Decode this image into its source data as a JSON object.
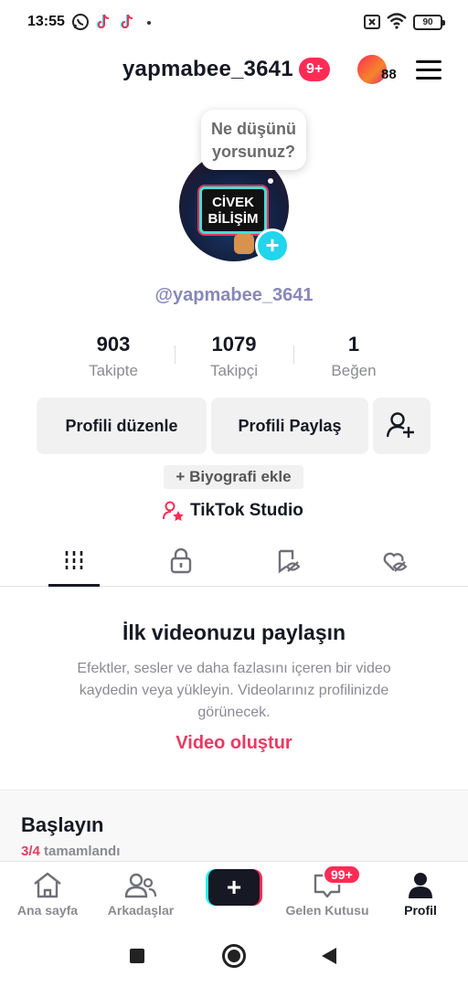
{
  "status_bar": {
    "time": "13:55",
    "battery": "90"
  },
  "header": {
    "username": "yapmabee_3641",
    "notification_badge": "9+",
    "stories_count": "88"
  },
  "profile": {
    "avatar_text_line1": "CİVEK",
    "avatar_text_line2": "BİLİŞİM",
    "thought_bubble_line1": "Ne düşünü",
    "thought_bubble_line2": "yorsunuz?",
    "handle": "@yapmabee_3641"
  },
  "stats": [
    {
      "value": "903",
      "label": "Takipte"
    },
    {
      "value": "1079",
      "label": "Takipçi"
    },
    {
      "value": "1",
      "label": "Beğen"
    }
  ],
  "actions": {
    "edit_profile": "Profili düzenle",
    "share_profile": "Profili Paylaş",
    "add_bio": "+ Biyografi ekle",
    "studio": "TikTok Studio"
  },
  "tabs": [
    "videos-grid",
    "private",
    "reposts",
    "liked"
  ],
  "empty_state": {
    "title": "İlk videonuzu paylaşın",
    "description": "Efektler, sesler ve daha fazlasını içeren bir video kaydedin veya yükleyin. Videolarınız profilinizde görünecek.",
    "cta": "Video oluştur"
  },
  "get_started": {
    "title": "Başlayın",
    "progress": "3/4",
    "progress_suffix": " tamamlandı"
  },
  "bottom_nav": {
    "home": "Ana sayfa",
    "friends": "Arkadaşlar",
    "create": "+",
    "inbox": "Gelen Kutusu",
    "inbox_badge": "99+",
    "profile": "Profil"
  },
  "colors": {
    "accent_red": "#fe2c55",
    "accent_cyan": "#25f4ee",
    "link_red": "#e83a62",
    "handle_purple": "#8887b8"
  }
}
